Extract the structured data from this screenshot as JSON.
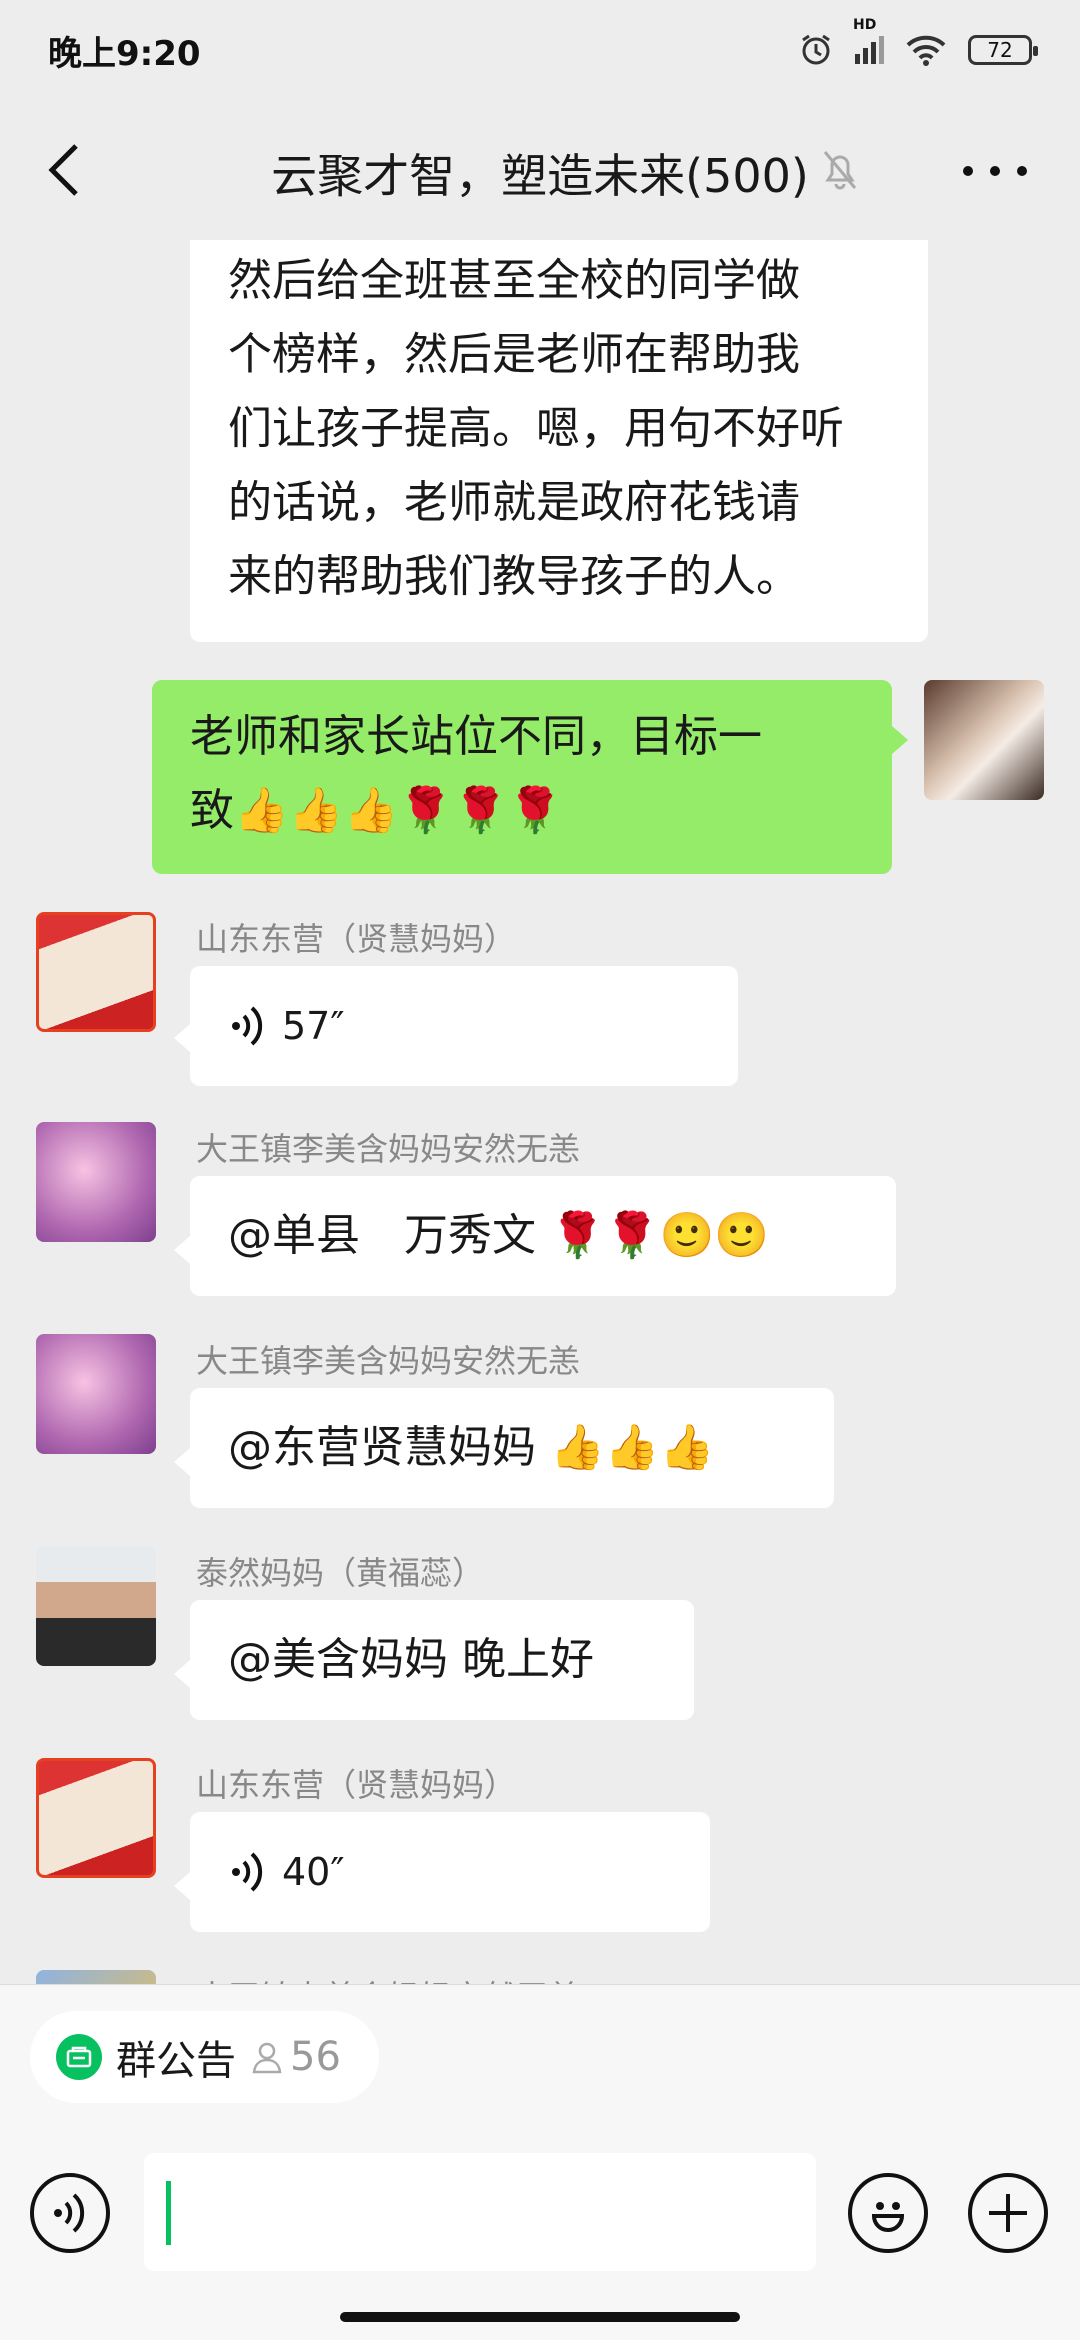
{
  "status": {
    "time": "晚上9:20",
    "hd": "HD",
    "battery": "72"
  },
  "nav": {
    "title": "云聚才智，塑造未来(500)"
  },
  "messages": {
    "m1": {
      "lines": [
        "然后给全班甚至全校的同学做",
        "个榜样，然后是老师在帮助我",
        "们让孩子提高。嗯，用句不好听",
        "的话说，老师就是政府花钱请",
        "来的帮助我们教导孩子的人。"
      ]
    },
    "m2": {
      "lines": [
        "老师和家长站位不同，目标一",
        "致👍👍👍🌹🌹🌹"
      ]
    },
    "m3": {
      "sender": "山东东营（贤慧妈妈）",
      "duration": "57″"
    },
    "m4": {
      "sender": "大王镇李美含妈妈安然无恙",
      "text": "@单县　万秀文 🌹🌹🙂🙂"
    },
    "m5": {
      "sender": "大王镇李美含妈妈安然无恙",
      "text": "@东营贤慧妈妈 👍👍👍"
    },
    "m6": {
      "sender": "泰然妈妈（黄福蕊）",
      "text": "@美含妈妈  晚上好"
    },
    "m7": {
      "sender": "山东东营（贤慧妈妈）",
      "duration": "40″"
    },
    "m8": {
      "sender": "大王镇李美含妈妈安然无恙"
    }
  },
  "bottom": {
    "notice_label": "群公告",
    "member_count": "56"
  },
  "colors": {
    "accent": "#07c160",
    "my_bubble": "#95ec69",
    "background": "#ededed"
  }
}
